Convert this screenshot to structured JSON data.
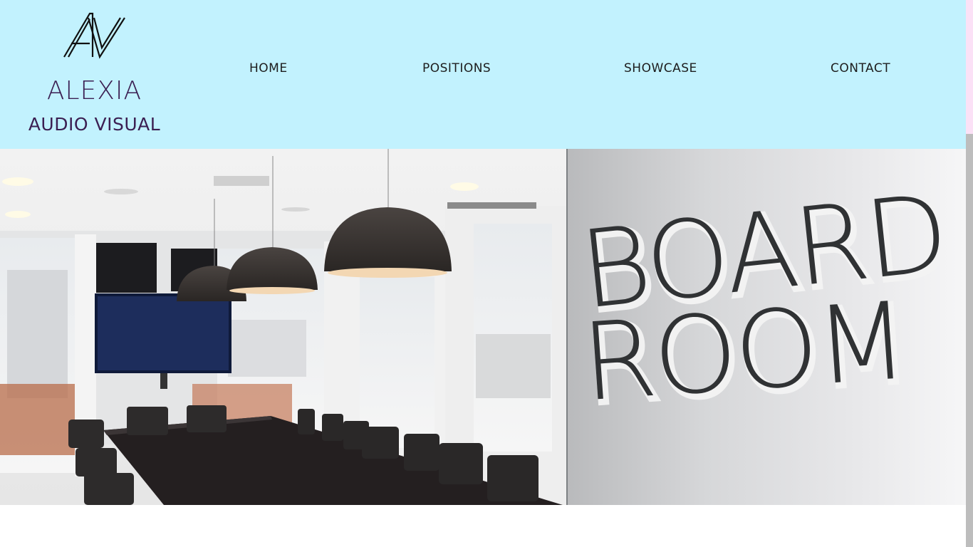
{
  "brand": {
    "name": "ALEXIA",
    "subtitle": "AUDIO VISUAL",
    "color": "#3b1f52"
  },
  "nav": {
    "items": [
      {
        "label": "HOME"
      },
      {
        "label": "POSITIONS"
      },
      {
        "label": "SHOWCASE"
      },
      {
        "label": "CONTACT"
      }
    ]
  },
  "hero": {
    "sign_line1": "BOARD",
    "sign_line2": "ROOM"
  },
  "colors": {
    "header_bg": "#c2f2fe",
    "scroll_thumb": "#fbe1f6",
    "scroll_track": "#bdbdbd"
  }
}
